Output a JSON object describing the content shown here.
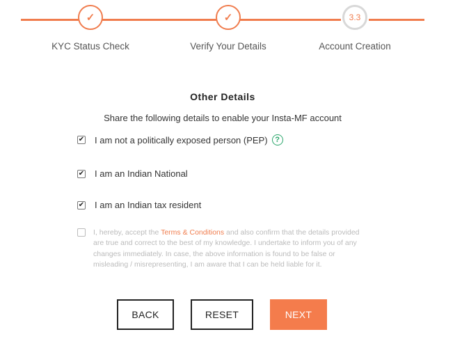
{
  "stepper": {
    "steps": [
      {
        "label": "KYC Status Check",
        "status": "done",
        "icon": "check-icon",
        "mark": "✓"
      },
      {
        "label": "Verify Your Details",
        "status": "done",
        "icon": "check-icon",
        "mark": "✓"
      },
      {
        "label": "Account Creation",
        "status": "current",
        "number": "3.3"
      }
    ]
  },
  "form": {
    "title": "Other Details",
    "subtitle": "Share the following details to enable your Insta-MF account",
    "checks": [
      {
        "label": "I am not a politically exposed person (PEP)",
        "checked": true,
        "check_mark": "✔"
      },
      {
        "label": "I am an Indian National",
        "checked": true,
        "check_mark": "✔"
      },
      {
        "label": "I am an Indian tax resident",
        "checked": true,
        "check_mark": "✔"
      }
    ],
    "help_icon": {
      "name": "help-icon",
      "glyph": "?"
    },
    "terms": {
      "checked": false,
      "prefix": "I, hereby, accept the ",
      "link": "Terms & Conditions",
      "suffix": " and also confirm that the details provided are true and correct to the best of my knowledge. I undertake to inform you of any changes immediately. In case, the above information is found to be false or misleading / misrepresenting, I am aware that I can be held liable for it."
    }
  },
  "buttons": {
    "back": "BACK",
    "reset": "RESET",
    "next": "NEXT"
  },
  "colors": {
    "accent": "#f07c4d",
    "help": "#2aa66b",
    "muted_text": "#bbbbbb"
  }
}
